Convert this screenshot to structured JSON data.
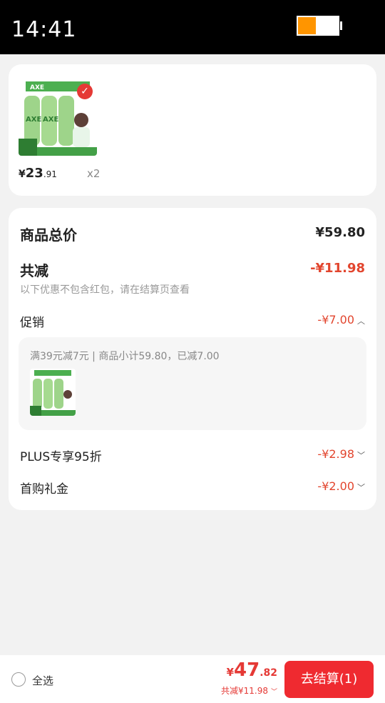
{
  "status_bar": {
    "time": "14:41",
    "battery_level": 0.45,
    "battery_color": "#ff9500"
  },
  "product": {
    "image_icon": "product-bottles-image",
    "badge_icon": "check-icon",
    "price_symbol": "¥",
    "price_int": "23",
    "price_dec": ".91",
    "quantity": "x2"
  },
  "summary": {
    "total_label": "商品总价",
    "total_value": "¥59.80",
    "reduce_label": "共减",
    "reduce_value": "-¥11.98",
    "reduce_note": "以下优惠不包含红包，请在结算页查看",
    "promo_label": "促销",
    "promo_value": "-¥7.00",
    "promo_desc": "满39元减7元 | 商品小计59.80，已减7.00",
    "plus_label": "PLUS专享95折",
    "plus_value": "-¥2.98",
    "first_label": "首购礼金",
    "first_value": "-¥2.00"
  },
  "bottom": {
    "select_all": "全选",
    "price_symbol": "¥",
    "price_int": "47",
    "price_dec": ".82",
    "reduce_text": "共减¥11.98",
    "checkout_label": "去结算(1)"
  },
  "colors": {
    "accent": "#e2452e",
    "checkout": "#ef2a30"
  }
}
